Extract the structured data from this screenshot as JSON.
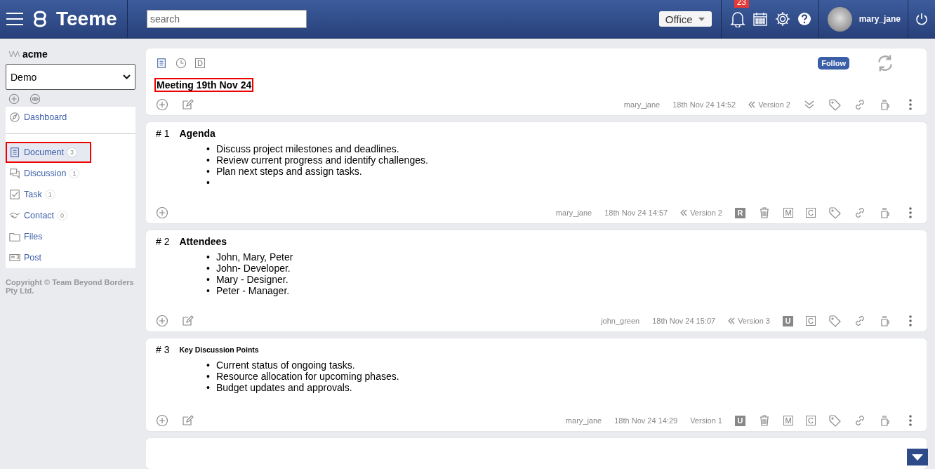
{
  "header": {
    "logo": "Teeme",
    "search": {
      "placeholder": "search"
    },
    "space_select": "Office",
    "notifications": "23",
    "user": "mary_jane"
  },
  "sidebar": {
    "org": "acme",
    "workspace": "Demo",
    "items": [
      {
        "label": "Dashboard",
        "kind": "dashboard",
        "selected": false,
        "highlighted": false
      },
      {
        "label": "Document",
        "kind": "document",
        "count": "3",
        "selected": true,
        "highlighted": true
      },
      {
        "label": "Discussion",
        "kind": "discussion",
        "count": "1",
        "selected": false,
        "highlighted": false
      },
      {
        "label": "Task",
        "kind": "task",
        "count": "1",
        "selected": false,
        "highlighted": false
      },
      {
        "label": "Contact",
        "kind": "contact",
        "count": "0",
        "selected": false,
        "highlighted": false
      },
      {
        "label": "Files",
        "kind": "files",
        "selected": false,
        "highlighted": false
      },
      {
        "label": "Post",
        "kind": "post",
        "selected": false,
        "highlighted": false
      }
    ],
    "copyright": "Copyright © Team Beyond Borders Pty Ltd."
  },
  "document": {
    "draft_badge": "D",
    "title": "Meeting 19th Nov 24",
    "title_highlighted": true,
    "follow": "Follow",
    "author": "mary_jane",
    "date": "18th Nov 24 14:52",
    "version": "Version 2",
    "version_history": true
  },
  "sections": [
    {
      "number": "# 1",
      "title": "Agenda",
      "kind": "heading",
      "edit": false,
      "author": "mary_jane",
      "date": "18th Nov 24 14:57",
      "version": "Version 2",
      "version_history": true,
      "status": "R",
      "actions": [
        {
          "kind": "delete"
        },
        {
          "kind": "move",
          "label": "M"
        },
        {
          "kind": "copy",
          "label": "C"
        }
      ],
      "items": [
        {
          "bullet": "•",
          "text": "Discuss project milestones and deadlines."
        },
        {
          "bullet": "•",
          "text": "Review current progress and identify challenges."
        },
        {
          "bullet": "•",
          "text": "Plan next steps and assign tasks."
        },
        {
          "bullet": "•"
        }
      ]
    },
    {
      "number": "# 2",
      "title": "Attendees",
      "kind": "heading",
      "edit": true,
      "author": "john_green",
      "date": "18th Nov 24 15:07",
      "version": "Version 3",
      "version_history": true,
      "status": "U",
      "actions": [
        {
          "kind": "copy",
          "label": "C"
        }
      ],
      "items": [
        {
          "bullet": "•",
          "text": "John, Mary, Peter"
        },
        {
          "bullet": "•",
          "text": "John- Developer."
        },
        {
          "bullet": "•",
          "text": "Mary - Designer."
        },
        {
          "bullet": "•",
          "text": "Peter - Manager."
        }
      ]
    },
    {
      "number": "# 3",
      "title": "Key Discussion Points",
      "kind": "subheading",
      "edit": true,
      "author": "mary_jane",
      "date": "18th Nov 24 14:29",
      "version": "Version 1",
      "version_history": false,
      "status": "U",
      "actions": [
        {
          "kind": "delete"
        },
        {
          "kind": "move",
          "label": "M"
        },
        {
          "kind": "copy",
          "label": "C"
        }
      ],
      "items": [
        {
          "bullet": "•",
          "text": "Current status of ongoing tasks."
        },
        {
          "bullet": "•",
          "text": "Resource allocation for upcoming phases."
        },
        {
          "bullet": "•",
          "text": "Budget updates and approvals."
        }
      ]
    }
  ],
  "next_section_partial": true
}
